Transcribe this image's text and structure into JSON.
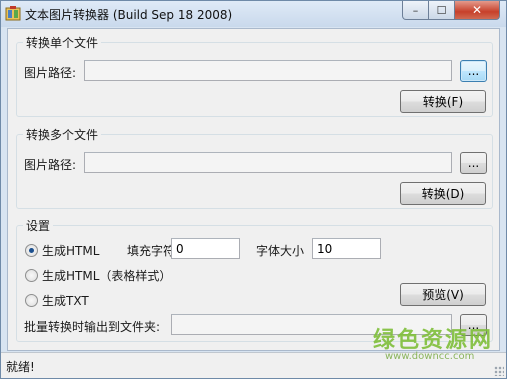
{
  "window": {
    "title": "文本图片转换器 (Build Sep 18 2008)",
    "close_glyph": "✕",
    "max_glyph": "☐",
    "min_glyph": "–"
  },
  "single": {
    "group_title": "转换单个文件",
    "path_label": "图片路径:",
    "path_value": "",
    "browse_label": "...",
    "convert_label": "转换(F)"
  },
  "multi": {
    "group_title": "转换多个文件",
    "path_label": "图片路径:",
    "path_value": "",
    "browse_label": "...",
    "convert_label": "转换(D)"
  },
  "settings": {
    "group_title": "设置",
    "radio_html": "生成HTML",
    "radio_html_table": "生成HTML（表格样式）",
    "radio_txt": "生成TXT",
    "selected": "生成HTML",
    "fill_char_label": "填充字符",
    "fill_char_value": "0",
    "font_size_label": "字体大小",
    "font_size_value": "10",
    "preview_label": "预览(V)",
    "batch_output_label": "批量转换时输出到文件夹:",
    "batch_output_value": "",
    "browse_label": "..."
  },
  "status": {
    "text": "就绪!"
  },
  "watermark": {
    "logo": "绿色资源网",
    "url": "www.downcc.com"
  },
  "colors": {
    "frame": "#d8e4f1",
    "client": "#f0f0f0",
    "close_button": "#c7402a",
    "focus_button": "#3c7fb1",
    "watermark": "#7fbf3a"
  }
}
